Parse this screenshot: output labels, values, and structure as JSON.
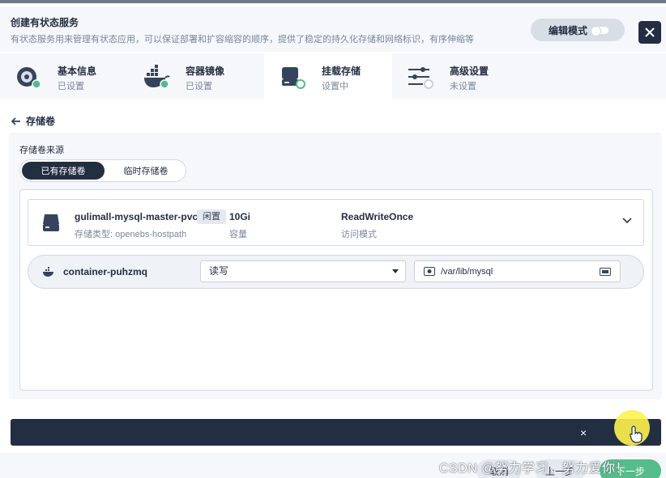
{
  "header": {
    "title": "创建有状态服务",
    "description": "有状态服务用来管理有状态应用，可以保证部署和扩容缩容的顺序，提供了稳定的持久化存储和网络标识，有序伸缩等",
    "edit_mode_label": "编辑模式"
  },
  "steps": [
    {
      "name": "基本信息",
      "status": "已设置",
      "icon": "disc-icon"
    },
    {
      "name": "容器镜像",
      "status": "已设置",
      "icon": "docker-icon"
    },
    {
      "name": "挂载存储",
      "status": "设置中",
      "icon": "storage-icon"
    },
    {
      "name": "高级设置",
      "status": "未设置",
      "icon": "sliders-icon"
    }
  ],
  "section": {
    "title": "存储卷"
  },
  "source": {
    "label": "存储卷来源",
    "options": [
      "已有存储卷",
      "临时存储卷"
    ],
    "selected": "已有存储卷"
  },
  "volume": {
    "name": "gulimall-mysql-master-pvc",
    "badge": "闲置",
    "type": "存储类型: openebs-hostpath",
    "capacity": "10Gi",
    "capacity_label": "容量",
    "access_mode": "ReadWriteOnce",
    "access_mode_label": "访问模式"
  },
  "mount": {
    "container": "container-puhzmq",
    "permission": "读写",
    "path": "/var/lib/mysql"
  },
  "footer": {
    "cancel": "取消",
    "prev": "上一步",
    "next": "下一步"
  },
  "watermark": "CSDN @努力学习，努力爱你！",
  "colors": {
    "dark": "#242e42",
    "accent_green": "#55bc8a",
    "panel": "#f5f7fa"
  }
}
